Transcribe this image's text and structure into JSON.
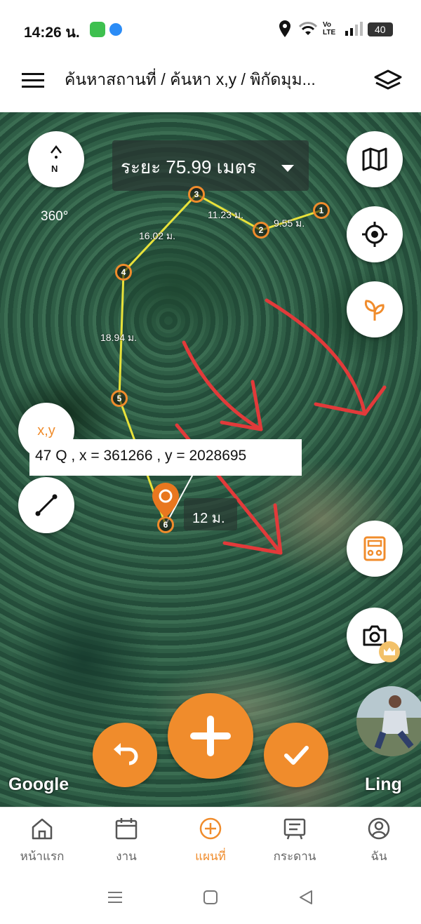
{
  "status_bar": {
    "time": "14:26 น.",
    "network_label": "Vo LTE",
    "battery": "40"
  },
  "app_bar": {
    "title": "ค้นหาสถานที่ / ค้นหา x,y / พิกัดมุม..."
  },
  "map": {
    "compass_label": "N",
    "rotation_label": "360°",
    "distance_text": "ระยะ 75.99 เมตร",
    "segments": [
      {
        "label": "9.55 ม."
      },
      {
        "label": "11.23 ม."
      },
      {
        "label": "16.02 ม."
      },
      {
        "label": "18.94 ม."
      }
    ],
    "vertices": [
      "1",
      "2",
      "3",
      "4",
      "5",
      "6"
    ],
    "xy_button_label": "x,y",
    "coordinate_text": "47 Q , x = 361266 , y = 2028695",
    "scale_text": "12 ม.",
    "google_mark": "Google",
    "user_name": "Ling"
  },
  "bottom_nav": {
    "items": [
      {
        "label": "หน้าแรก"
      },
      {
        "label": "งาน"
      },
      {
        "label": "แผนที่"
      },
      {
        "label": "กระดาน"
      },
      {
        "label": "ฉัน"
      }
    ]
  },
  "colors": {
    "accent": "#f08c2c",
    "route_line": "#e8e23a",
    "arrow_annotation": "#e23a3a"
  }
}
